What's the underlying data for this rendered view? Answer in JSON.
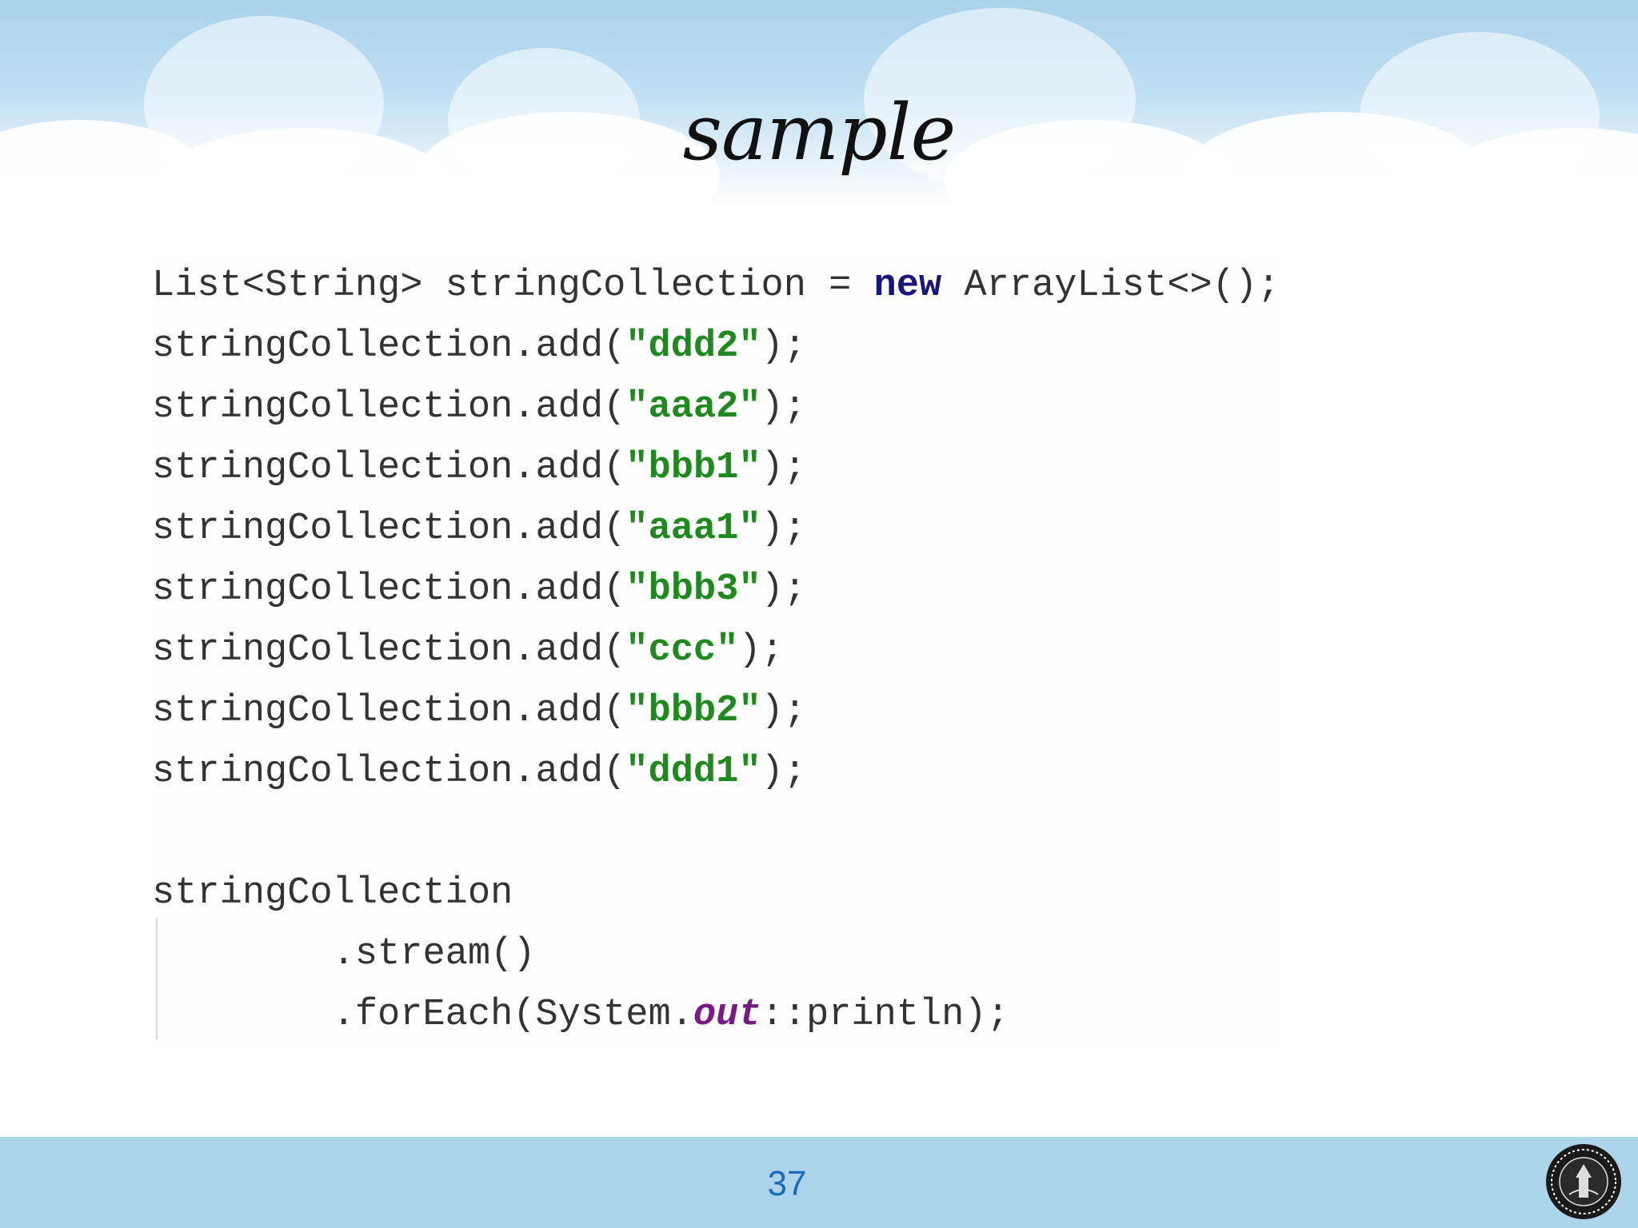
{
  "slide": {
    "title": "sample",
    "page_number": "37",
    "logo": "university-seal-icon"
  },
  "code": {
    "line1": {
      "pre": "List<String> stringCollection = ",
      "keyword": "new",
      "post": " ArrayList<>();"
    },
    "add_prefix": "stringCollection.add(",
    "add_suffix": ");",
    "adds": [
      "\"ddd2\"",
      "\"aaa2\"",
      "\"bbb1\"",
      "\"aaa1\"",
      "\"bbb3\"",
      "\"ccc\"",
      "\"bbb2\"",
      "\"ddd1\""
    ],
    "stream": {
      "receiver": "stringCollection",
      "call1": "        .stream()",
      "call2_pre": "        .forEach(System.",
      "call2_field": "out",
      "call2_post": "::println);"
    }
  },
  "colors": {
    "keyword": "#15157a",
    "string": "#1e8a1e",
    "field": "#7a1a86",
    "text": "#333333",
    "page_number": "#1b6cc0"
  }
}
